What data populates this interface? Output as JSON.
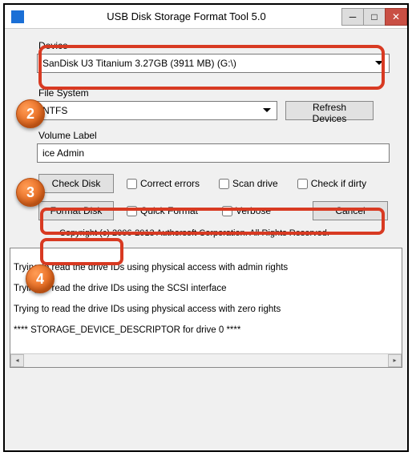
{
  "window": {
    "title": "USB Disk Storage Format Tool 5.0"
  },
  "device": {
    "label": "Device",
    "selected": "SanDisk U3 Titanium 3.27GB (3911 MB)  (G:\\)"
  },
  "filesystem": {
    "label": "File System",
    "selected": "NTFS",
    "refresh_btn": "Refresh Devices"
  },
  "volume": {
    "label": "Volume Label",
    "value": "ice Admin"
  },
  "check_row": {
    "check_disk_btn": "Check Disk",
    "correct_errors": "Correct errors",
    "scan_drive": "Scan drive",
    "check_dirty": "Check if dirty"
  },
  "format_row": {
    "format_btn": "Format Disk",
    "quick_format": "Quick Format",
    "verbose": "Verbose",
    "cancel_btn": "Cancel"
  },
  "copyright": "Copyright (c) 2006-2013 Authorsoft Corporation. All Rights Reserved.",
  "log": {
    "line1": "Trying to read the drive IDs using physical access with admin rights",
    "line2": "Trying to read the drive IDs using the SCSI interface",
    "line3": "Trying to read the drive IDs using physical access with zero rights",
    "line4": "**** STORAGE_DEVICE_DESCRIPTOR for drive 0 ****"
  },
  "markers": {
    "m2": "2",
    "m3": "3",
    "m4": "4"
  }
}
